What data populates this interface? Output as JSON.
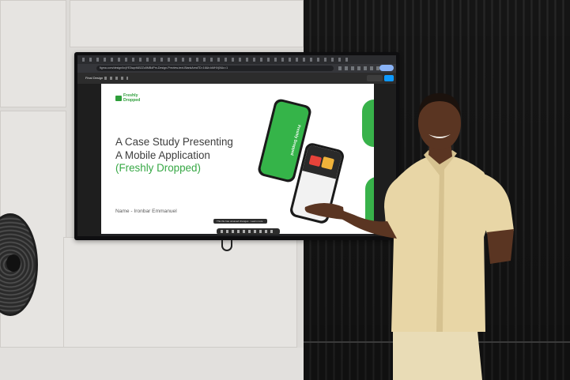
{
  "browser": {
    "url": "figma.com/design/kxjYE3sqvfAB2Zu5MBdPm-Design-Preview-text-BlankAreaTD=16&t=kMHVj0iUc=1",
    "tab_title": "Final Design"
  },
  "slide": {
    "logo_text": "Freshly\nDropped",
    "headline_line1": "A Case Study Presenting",
    "headline_line2": "A Mobile Application",
    "headline_line3": "(Freshly Dropped)",
    "name_line": "Name - Ironbar Emmanuel",
    "phone_label": "Freshly Dropped"
  },
  "figma_ui": {
    "toast_text": "This file has unsaved changes · Learn more"
  },
  "colors": {
    "brand_green": "#37a845",
    "headline_gray": "#3d3d3d",
    "shirt": "#e8d6a6"
  }
}
